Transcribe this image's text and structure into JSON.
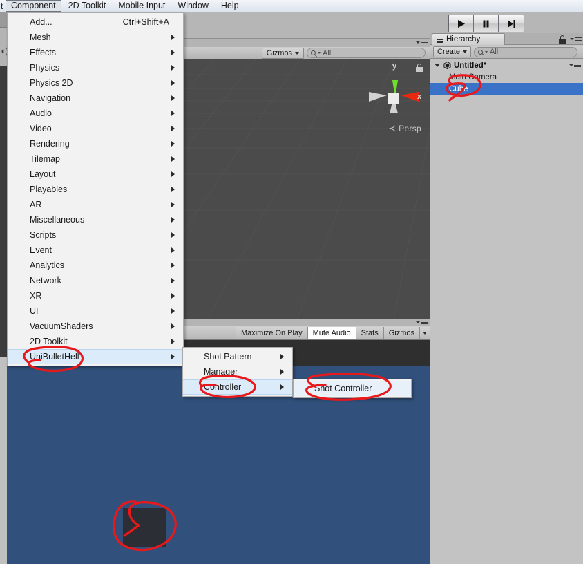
{
  "menubar": {
    "stub": "t",
    "items": [
      {
        "label": "Component",
        "active": true
      },
      {
        "label": "2D Toolkit",
        "active": false
      },
      {
        "label": "Mobile Input",
        "active": false
      },
      {
        "label": "Window",
        "active": false
      },
      {
        "label": "Help",
        "active": false
      }
    ]
  },
  "transport": {
    "play": "play-icon",
    "pause": "pause-icon",
    "step": "step-icon"
  },
  "scene_view": {
    "gizmos_label": "Gizmos",
    "search_value": "All",
    "axis": {
      "y": "y",
      "x": "x"
    },
    "projection": "Persp"
  },
  "game_view": {
    "buttons": [
      {
        "label": "Maximize On Play",
        "active": false
      },
      {
        "label": "Mute Audio",
        "active": true
      },
      {
        "label": "Stats",
        "active": false
      },
      {
        "label": "Gizmos",
        "active": false
      }
    ]
  },
  "hierarchy": {
    "tab_label": "Hierarchy",
    "create_label": "Create",
    "search_value": "All",
    "rows": [
      {
        "label": "Untitled*",
        "type": "scene",
        "selected": false
      },
      {
        "label": "Main Camera",
        "type": "object",
        "selected": false
      },
      {
        "label": "Cube",
        "type": "object",
        "selected": true
      }
    ]
  },
  "component_menu": {
    "items": [
      {
        "label": "Add...",
        "shortcut": "Ctrl+Shift+A",
        "submenu": false,
        "highlighted": false
      },
      {
        "label": "Mesh",
        "shortcut": "",
        "submenu": true,
        "highlighted": false
      },
      {
        "label": "Effects",
        "shortcut": "",
        "submenu": true,
        "highlighted": false
      },
      {
        "label": "Physics",
        "shortcut": "",
        "submenu": true,
        "highlighted": false
      },
      {
        "label": "Physics 2D",
        "shortcut": "",
        "submenu": true,
        "highlighted": false
      },
      {
        "label": "Navigation",
        "shortcut": "",
        "submenu": true,
        "highlighted": false
      },
      {
        "label": "Audio",
        "shortcut": "",
        "submenu": true,
        "highlighted": false
      },
      {
        "label": "Video",
        "shortcut": "",
        "submenu": true,
        "highlighted": false
      },
      {
        "label": "Rendering",
        "shortcut": "",
        "submenu": true,
        "highlighted": false
      },
      {
        "label": "Tilemap",
        "shortcut": "",
        "submenu": true,
        "highlighted": false
      },
      {
        "label": "Layout",
        "shortcut": "",
        "submenu": true,
        "highlighted": false
      },
      {
        "label": "Playables",
        "shortcut": "",
        "submenu": true,
        "highlighted": false
      },
      {
        "label": "AR",
        "shortcut": "",
        "submenu": true,
        "highlighted": false
      },
      {
        "label": "Miscellaneous",
        "shortcut": "",
        "submenu": true,
        "highlighted": false
      },
      {
        "label": "Scripts",
        "shortcut": "",
        "submenu": true,
        "highlighted": false
      },
      {
        "label": "Event",
        "shortcut": "",
        "submenu": true,
        "highlighted": false
      },
      {
        "label": "Analytics",
        "shortcut": "",
        "submenu": true,
        "highlighted": false
      },
      {
        "label": "Network",
        "shortcut": "",
        "submenu": true,
        "highlighted": false
      },
      {
        "label": "XR",
        "shortcut": "",
        "submenu": true,
        "highlighted": false
      },
      {
        "label": "UI",
        "shortcut": "",
        "submenu": true,
        "highlighted": false
      },
      {
        "label": "VacuumShaders",
        "shortcut": "",
        "submenu": true,
        "highlighted": false
      },
      {
        "label": "2D Toolkit",
        "shortcut": "",
        "submenu": true,
        "highlighted": false
      },
      {
        "label": "UniBulletHell",
        "shortcut": "",
        "submenu": true,
        "highlighted": true
      }
    ]
  },
  "ubh_menu": {
    "items": [
      {
        "label": "Shot Pattern",
        "submenu": true,
        "highlighted": false
      },
      {
        "label": "Manager",
        "submenu": true,
        "highlighted": false
      },
      {
        "label": "Controller",
        "submenu": true,
        "highlighted": true
      }
    ]
  },
  "controller_menu": {
    "items": [
      {
        "label": "Shot Controller",
        "submenu": false,
        "highlighted": false
      }
    ]
  },
  "annotations": {
    "circles": [
      {
        "target": "UniBulletHell"
      },
      {
        "target": "Controller"
      },
      {
        "target": "Shot Controller"
      },
      {
        "target": "Cube"
      },
      {
        "target": "game-cube"
      }
    ],
    "color": "#e8181b"
  },
  "colors": {
    "menu_highlight": "#dcebfa",
    "hierarchy_selection": "#3a72c8",
    "game_background": "#31507b",
    "scene_background": "#4b4b4b",
    "panel_background": "#c3c3c3"
  }
}
